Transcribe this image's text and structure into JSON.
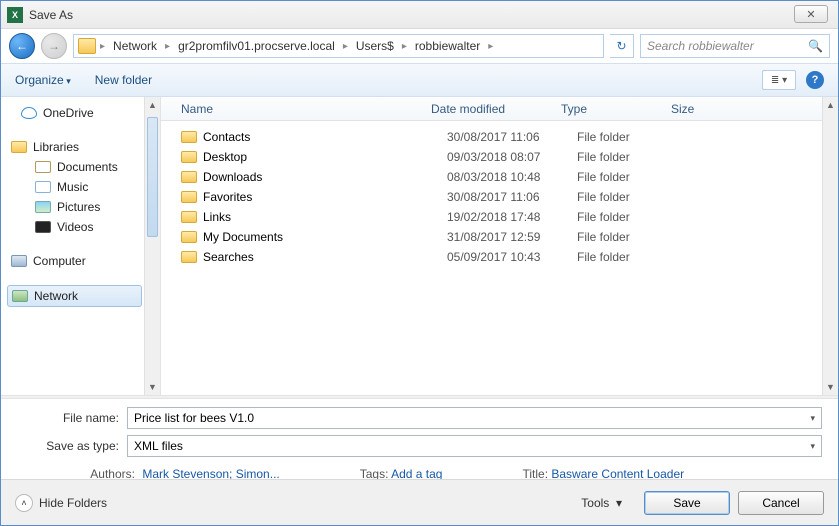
{
  "window": {
    "title": "Save As"
  },
  "breadcrumb": {
    "items": [
      "Network",
      "gr2promfilv01.procserve.local",
      "Users$",
      "robbiewalter"
    ]
  },
  "search": {
    "placeholder": "Search robbiewalter"
  },
  "toolbar": {
    "organize": "Organize",
    "new_folder": "New folder"
  },
  "nav": {
    "onedrive": "OneDrive",
    "libraries": "Libraries",
    "documents": "Documents",
    "music": "Music",
    "pictures": "Pictures",
    "videos": "Videos",
    "computer": "Computer",
    "network": "Network"
  },
  "columns": {
    "name": "Name",
    "date": "Date modified",
    "type": "Type",
    "size": "Size"
  },
  "rows": [
    {
      "name": "Contacts",
      "date": "30/08/2017 11:06",
      "type": "File folder"
    },
    {
      "name": "Desktop",
      "date": "09/03/2018 08:07",
      "type": "File folder"
    },
    {
      "name": "Downloads",
      "date": "08/03/2018 10:48",
      "type": "File folder"
    },
    {
      "name": "Favorites",
      "date": "30/08/2017 11:06",
      "type": "File folder"
    },
    {
      "name": "Links",
      "date": "19/02/2018 17:48",
      "type": "File folder"
    },
    {
      "name": "My Documents",
      "date": "31/08/2017 12:59",
      "type": "File folder"
    },
    {
      "name": "Searches",
      "date": "05/09/2017 10:43",
      "type": "File folder"
    }
  ],
  "fields": {
    "filename_label": "File name:",
    "filename_value": "Price list for bees V1.0",
    "saveas_label": "Save as type:",
    "saveas_value": "XML files"
  },
  "meta": {
    "authors_label": "Authors:",
    "authors_value": "Mark Stevenson; Simon...",
    "tags_label": "Tags:",
    "tags_value": "Add a tag",
    "title_label": "Title:",
    "title_value": "Basware Content Loader"
  },
  "footer": {
    "hide_folders": "Hide Folders",
    "tools": "Tools",
    "save": "Save",
    "cancel": "Cancel"
  }
}
